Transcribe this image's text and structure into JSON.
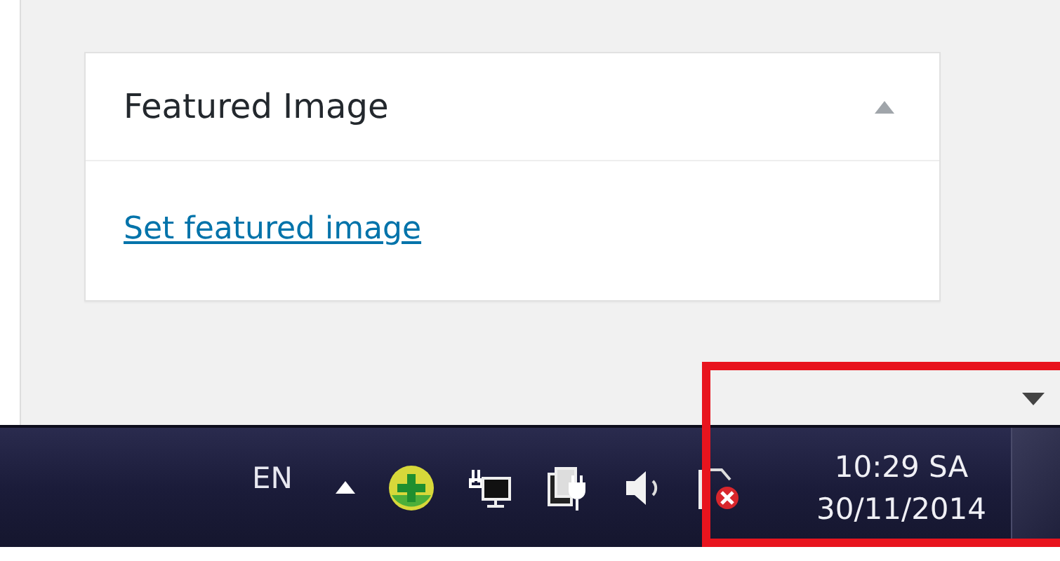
{
  "panel": {
    "title": "Featured Image",
    "expanded": true,
    "link": "Set featured image"
  },
  "taskbar": {
    "language": "EN",
    "time": "10:29 SA",
    "date": "30/11/2014"
  },
  "annotation": {
    "kind": "rectangle"
  }
}
